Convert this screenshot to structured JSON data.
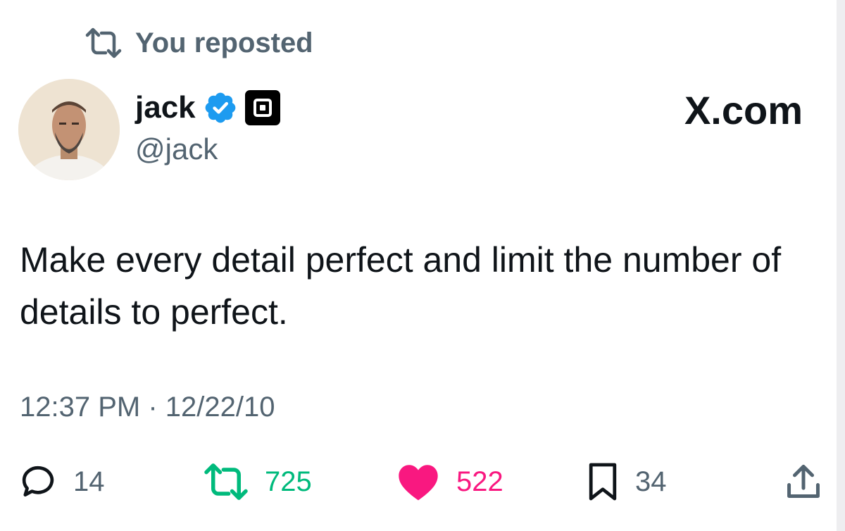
{
  "repost_context": {
    "text": "You reposted",
    "icon": "repost-icon"
  },
  "author": {
    "display_name": "jack",
    "handle": "@jack",
    "verified_icon": "verified-badge-icon",
    "affiliate_icon": "square-logo-icon",
    "avatar": "profile-photo"
  },
  "source_label": "X.com",
  "tweet": {
    "text": "Make every detail perfect and limit the number of details to perfect.",
    "timestamp": "12:37 PM · 12/22/10"
  },
  "actions": {
    "replies": "14",
    "reposts": "725",
    "likes": "522",
    "bookmarks": "34",
    "icons": [
      "reply-icon",
      "repost-icon",
      "heart-icon",
      "bookmark-icon",
      "share-icon"
    ]
  },
  "colors": {
    "text_primary": "#0f1419",
    "text_secondary": "#536471",
    "repost_green": "#00ba7c",
    "like_pink": "#f91880",
    "verified_blue": "#1d9bf0"
  }
}
